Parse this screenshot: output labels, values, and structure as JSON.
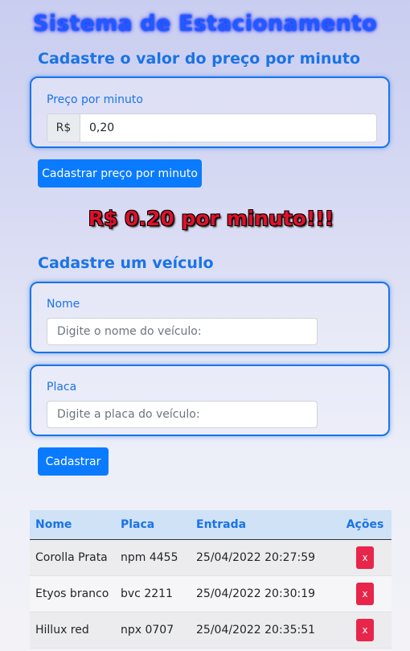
{
  "app": {
    "title": "Sistema de Estacionamento"
  },
  "price_section": {
    "title": "Cadastre o valor do preço por minuto",
    "label": "Preço por minuto",
    "currency_addon": "R$",
    "value": "0,20",
    "button": "Cadastrar preço por minuto"
  },
  "price_banner": "R$ 0.20 por minuto!!!",
  "vehicle_section": {
    "title": "Cadastre um veículo",
    "name_label": "Nome",
    "name_placeholder": "Digite o nome do veículo:",
    "plate_label": "Placa",
    "plate_placeholder": "Digite a placa do veículo:",
    "button": "Cadastrar"
  },
  "table": {
    "headers": [
      "Nome",
      "Placa",
      "Entrada",
      "Ações"
    ],
    "rows": [
      {
        "nome": "Corolla Prata",
        "placa": "npm 4455",
        "entrada": "25/04/2022 20:27:59",
        "action": "x"
      },
      {
        "nome": "Etyos branco",
        "placa": "bvc 2211",
        "entrada": "25/04/2022 20:30:19",
        "action": "x"
      },
      {
        "nome": "Hillux red",
        "placa": "npx 0707",
        "entrada": "25/04/2022 20:35:51",
        "action": "x"
      }
    ]
  },
  "colors": {
    "accent": "#1a73e8",
    "button": "#0a7bff",
    "danger": "#e8254a",
    "banner": "#e0102a"
  }
}
